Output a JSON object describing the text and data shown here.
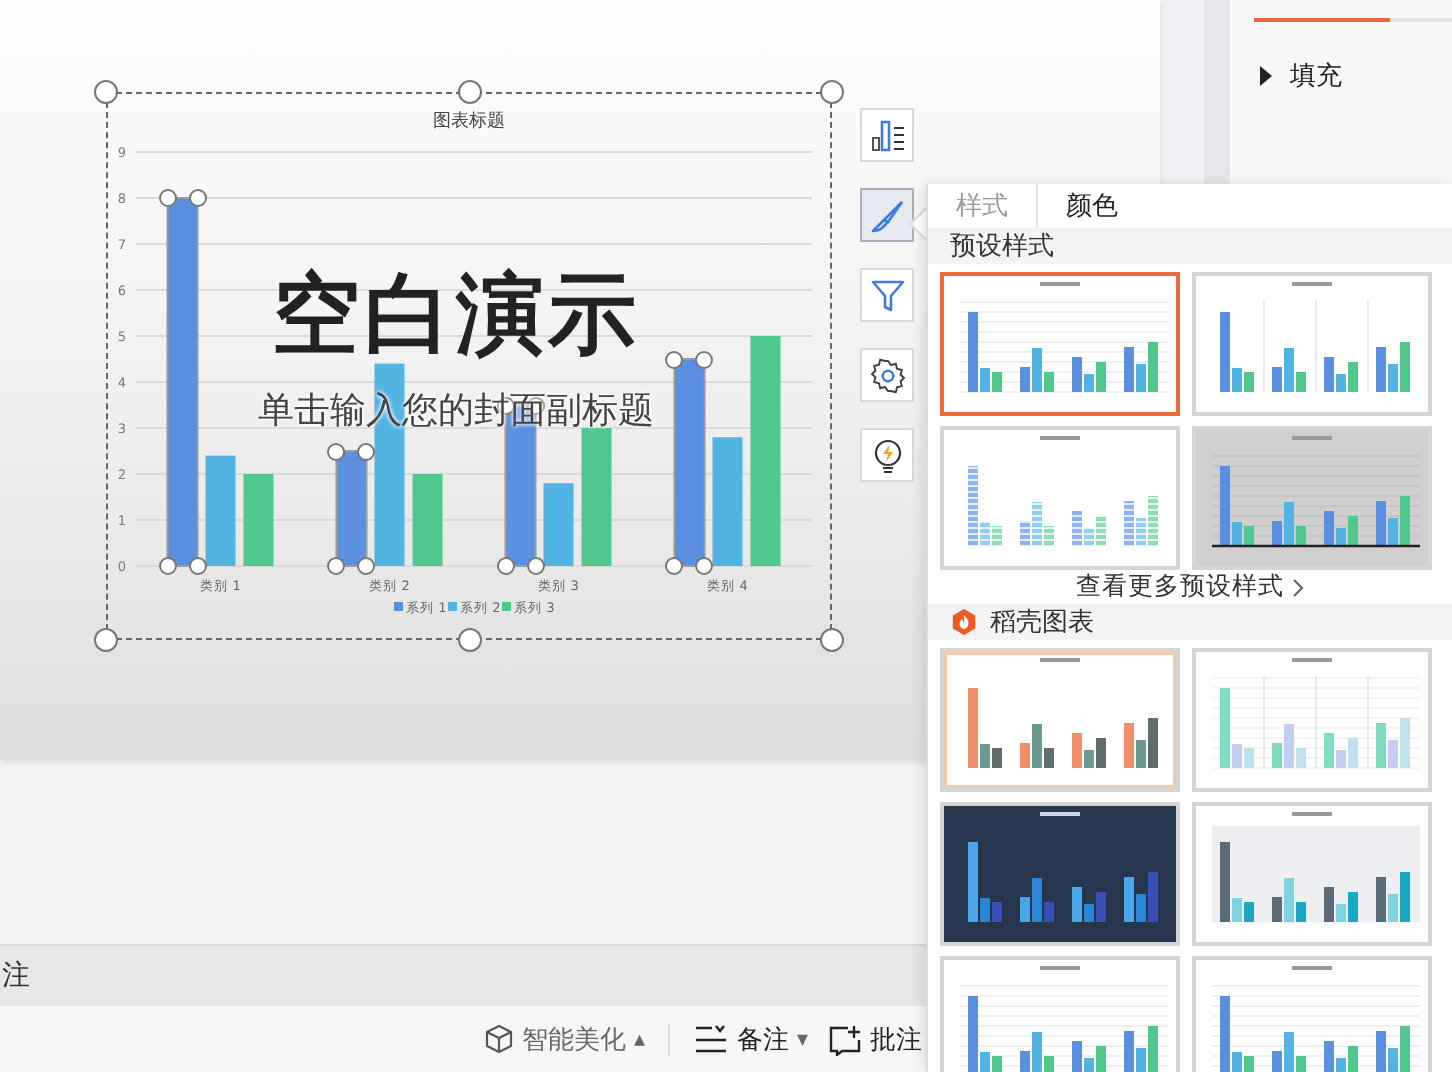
{
  "slide": {
    "title": "空白演示",
    "subtitle": "单击输入您的封面副标题"
  },
  "chart": {
    "selected": true,
    "series_selected": [
      true,
      false,
      false
    ],
    "chart_data": {
      "type": "bar",
      "title": "图表标题",
      "categories": [
        "类别 1",
        "类别 2",
        "类别 3",
        "类别 4"
      ],
      "series": [
        {
          "name": "系列 1",
          "color": "#5b8fe0",
          "values": [
            8,
            2.5,
            3.5,
            4.5
          ]
        },
        {
          "name": "系列 2",
          "color": "#52b4e3",
          "values": [
            2.4,
            4.4,
            1.8,
            2.8
          ]
        },
        {
          "name": "系列 3",
          "color": "#4fc78d",
          "values": [
            2,
            2,
            3,
            5
          ]
        }
      ],
      "ylim": [
        0,
        9
      ],
      "yticks": [
        0,
        1,
        2,
        3,
        4,
        5,
        6,
        7,
        8,
        9
      ],
      "grid": true,
      "legend": true
    }
  },
  "chart_tools": [
    {
      "kind": "elements",
      "selected": false
    },
    {
      "kind": "style",
      "selected": true
    },
    {
      "kind": "filter",
      "selected": false
    },
    {
      "kind": "settings",
      "selected": false
    },
    {
      "kind": "quick",
      "selected": false
    }
  ],
  "property_pane": {
    "sections": [
      {
        "label": "填充",
        "expanded": false
      }
    ]
  },
  "notes": {
    "text": "注"
  },
  "status_bar": {
    "items": [
      {
        "kind": "beautify",
        "label": "智能美化",
        "caret": "▴"
      },
      {
        "kind": "notes",
        "label": "备注",
        "caret": "▾"
      },
      {
        "kind": "comment",
        "label": "批注"
      }
    ]
  },
  "style_popup": {
    "tabs": [
      {
        "label": "样式",
        "selected": true
      },
      {
        "label": "颜色",
        "selected": false
      }
    ],
    "preset_heading": "预设样式",
    "presets": [
      {
        "kind": "plain",
        "selected": true
      },
      {
        "kind": "separated",
        "selected": false
      },
      {
        "kind": "striped",
        "selected": false
      },
      {
        "kind": "shaded",
        "selected": false
      }
    ],
    "more_link": "查看更多预设样式",
    "docer_heading": "稻壳图表",
    "docer": [
      {
        "kind": "orange",
        "selected": false
      },
      {
        "kind": "mint",
        "selected": false
      },
      {
        "kind": "dark",
        "selected": false
      },
      {
        "kind": "teal",
        "selected": false
      },
      {
        "kind": "plain",
        "selected": false
      },
      {
        "kind": "plain",
        "selected": false
      }
    ]
  }
}
